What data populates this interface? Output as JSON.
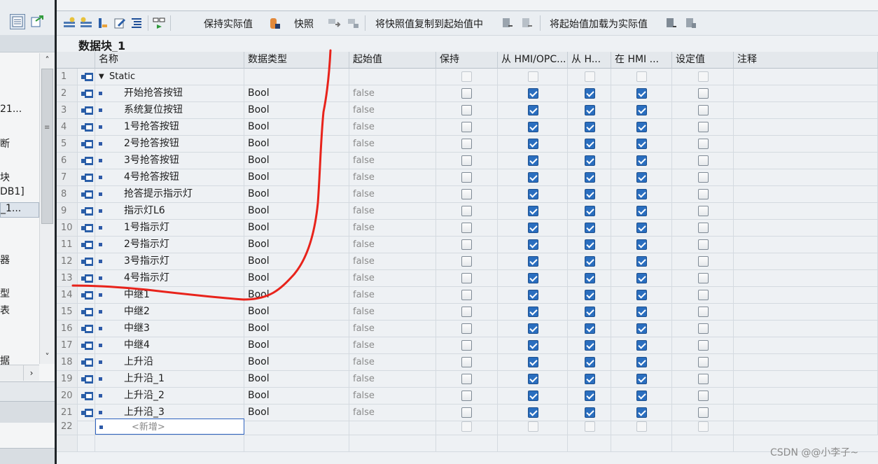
{
  "left_panel": {
    "labels": [
      "21...",
      "断",
      "块",
      "DB1]",
      "_1...",
      "器",
      "型",
      "表",
      "据"
    ],
    "selected_index": 4
  },
  "toolbar": {
    "keep_actual": "保持实际值",
    "snapshot": "快照",
    "copy_snapshot": "将快照值复制到起始值中",
    "load_start": "将起始值加载为实际值"
  },
  "block_title": "数据块_1",
  "columns": {
    "name": "名称",
    "type": "数据类型",
    "start": "起始值",
    "retain": "保持",
    "hmi1": "从 HMI/OPC...",
    "hmi2": "从 H...",
    "hmi3": "在 HMI ...",
    "setpoint": "设定值",
    "comment": "注释"
  },
  "static_row": {
    "num": "1",
    "name": "Static"
  },
  "rows": [
    {
      "num": "2",
      "name": "开始抢答按钮",
      "type": "Bool",
      "start": "false"
    },
    {
      "num": "3",
      "name": "系统复位按钮",
      "type": "Bool",
      "start": "false"
    },
    {
      "num": "4",
      "name": "1号抢答按钮",
      "type": "Bool",
      "start": "false"
    },
    {
      "num": "5",
      "name": "2号抢答按钮",
      "type": "Bool",
      "start": "false"
    },
    {
      "num": "6",
      "name": "3号抢答按钮",
      "type": "Bool",
      "start": "false"
    },
    {
      "num": "7",
      "name": "4号抢答按钮",
      "type": "Bool",
      "start": "false"
    },
    {
      "num": "8",
      "name": "抢答提示指示灯",
      "type": "Bool",
      "start": "false"
    },
    {
      "num": "9",
      "name": "指示灯L6",
      "type": "Bool",
      "start": "false"
    },
    {
      "num": "10",
      "name": "1号指示灯",
      "type": "Bool",
      "start": "false"
    },
    {
      "num": "11",
      "name": "2号指示灯",
      "type": "Bool",
      "start": "false"
    },
    {
      "num": "12",
      "name": "3号指示灯",
      "type": "Bool",
      "start": "false"
    },
    {
      "num": "13",
      "name": "4号指示灯",
      "type": "Bool",
      "start": "false"
    },
    {
      "num": "14",
      "name": "中继1",
      "type": "Bool",
      "start": "false"
    },
    {
      "num": "15",
      "name": "中继2",
      "type": "Bool",
      "start": "false"
    },
    {
      "num": "16",
      "name": "中继3",
      "type": "Bool",
      "start": "false"
    },
    {
      "num": "17",
      "name": "中继4",
      "type": "Bool",
      "start": "false"
    },
    {
      "num": "18",
      "name": "上升沿",
      "type": "Bool",
      "start": "false"
    },
    {
      "num": "19",
      "name": "上升沿_1",
      "type": "Bool",
      "start": "false"
    },
    {
      "num": "20",
      "name": "上升沿_2",
      "type": "Bool",
      "start": "false"
    },
    {
      "num": "21",
      "name": "上升沿_3",
      "type": "Bool",
      "start": "false"
    }
  ],
  "flags": {
    "retain": false,
    "hmi1": true,
    "hmi2": true,
    "hmi3": true,
    "setpoint": false
  },
  "new_row": {
    "num": "22",
    "placeholder": "<新增>"
  },
  "colors": {
    "accent": "#2a6ebf",
    "annotation": "#e8231b"
  },
  "watermark": "CSDN @@小李子~"
}
